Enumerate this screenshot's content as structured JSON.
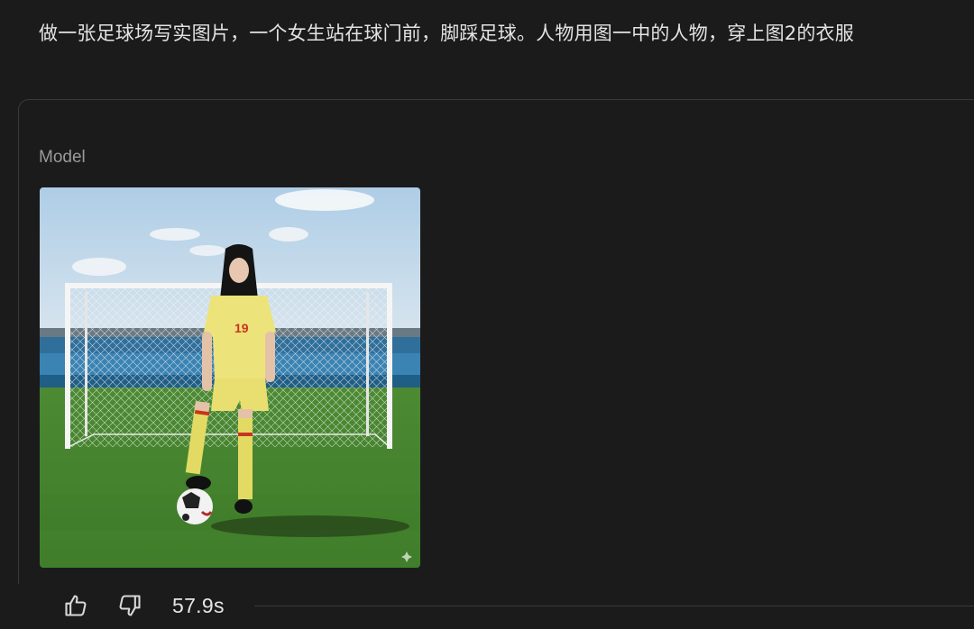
{
  "prompt": {
    "text": "做一张足球场写实图片，一个女生站在球门前，脚踩足球。人物用图一中的人物，穿上图2的衣服"
  },
  "response": {
    "role_label": "Model",
    "image": {
      "jersey_number": "19"
    },
    "footer": {
      "thumb_up_icon": "thumb-up-icon",
      "thumb_down_icon": "thumb-down-icon",
      "duration": "57.9s"
    }
  },
  "colors": {
    "background": "#1b1b1c",
    "text_primary": "#e3e3e3",
    "text_muted": "#9a9a9a",
    "border": "#3a3a3c"
  }
}
